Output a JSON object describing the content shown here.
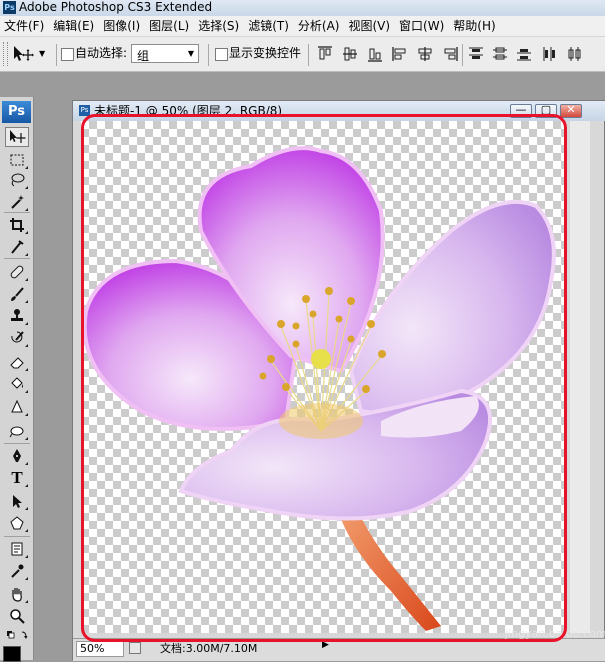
{
  "window": {
    "title": "Adobe Photoshop CS3 Extended",
    "app_icon": "Ps"
  },
  "menu": [
    "文件(F)",
    "编辑(E)",
    "图像(I)",
    "图层(L)",
    "选择(S)",
    "滤镜(T)",
    "分析(A)",
    "视图(V)",
    "窗口(W)",
    "帮助(H)"
  ],
  "options_bar": {
    "auto_select_label": "自动选择:",
    "auto_select_checked": false,
    "auto_select_value": "组",
    "show_transform_label": "显示变换控件",
    "show_transform_checked": false
  },
  "toolbox": {
    "logo": "Ps",
    "tools": [
      "move-tool",
      "marquee-tool",
      "lasso-tool",
      "magic-wand-tool",
      "crop-tool",
      "eyedropper-tool",
      "healing-brush-tool",
      "brush-tool",
      "clone-stamp-tool",
      "history-brush-tool",
      "eraser-tool",
      "paint-bucket-tool",
      "blur-tool",
      "dodge-tool",
      "pen-tool",
      "type-tool",
      "path-selection-tool",
      "custom-shape-tool",
      "notes-tool",
      "color-sampler-tool",
      "hand-tool",
      "zoom-tool"
    ],
    "type_tool_glyph": "T",
    "active_tool": "move-tool"
  },
  "document": {
    "title": "未标题-1 @ 50% (图层 2, RGB/8)",
    "zoom": "50%",
    "doc_info": "文档:3.00M/7.10M",
    "watermark": "jingyan.baidu.com"
  },
  "colors": {
    "highlight": "#e8122b",
    "petal": "#d36de8",
    "petal_light": "#eadcf5",
    "stem": "#e0602a",
    "stamen": "#d9a52a"
  }
}
